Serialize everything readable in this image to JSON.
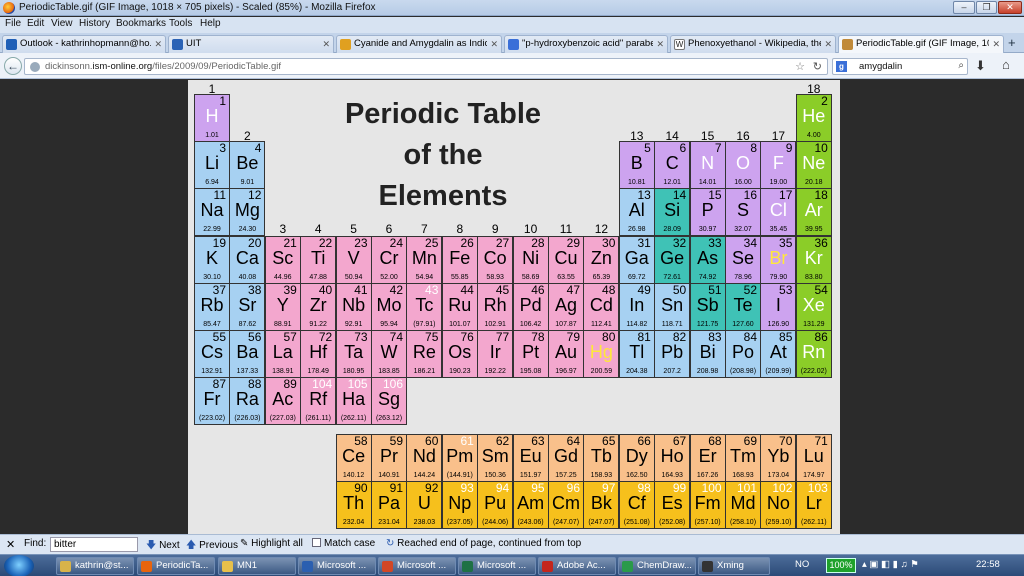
{
  "window": {
    "title": "PeriodicTable.gif (GIF Image, 1018 × 705 pixels) - Scaled (85%) - Mozilla Firefox"
  },
  "menu": [
    "File",
    "Edit",
    "View",
    "History",
    "Bookmarks",
    "Tools",
    "Help"
  ],
  "tabs": [
    {
      "label": "Outlook - kathrinhopmann@ho...",
      "color": "#1f5fb7"
    },
    {
      "label": "UIT",
      "color": "#2a62b5"
    },
    {
      "label": "Cyanide and Amygdalin as Indic...",
      "color": "#e0a020"
    },
    {
      "label": "\"p-hydroxybenzoic acid\" parabe...",
      "color": "#3a6fd8"
    },
    {
      "label": "Phenoxyethanol - Wikipedia, the...",
      "color": "#444444"
    },
    {
      "label": "PeriodicTable.gif (GIF Image, 10...",
      "color": "#c08a3a"
    }
  ],
  "new_tab": "+",
  "url": {
    "prefix": "dickinsonn.",
    "domain": "ism-online.org",
    "path": "/files/2009/09/PeriodicTable.gif"
  },
  "search": {
    "value": "amygdalin",
    "engine": "g"
  },
  "table": {
    "title_lines": [
      "Periodic Table",
      "of the",
      "Elements"
    ],
    "groups": [
      "1",
      "2",
      "3",
      "4",
      "5",
      "6",
      "7",
      "8",
      "9",
      "10",
      "11",
      "12",
      "13",
      "14",
      "15",
      "16",
      "17",
      "18"
    ],
    "elements": [
      {
        "z": "1",
        "sym": "H",
        "mass": "1.01",
        "col": 1,
        "row": 1,
        "cat": "nonmetal",
        "tc": "white"
      },
      {
        "z": "2",
        "sym": "He",
        "mass": "4.00",
        "col": 18,
        "row": 1,
        "cat": "noble",
        "tc": "white"
      },
      {
        "z": "3",
        "sym": "Li",
        "mass": "6.94",
        "col": 1,
        "row": 2,
        "cat": "alkali"
      },
      {
        "z": "4",
        "sym": "Be",
        "mass": "9.01",
        "col": 2,
        "row": 2,
        "cat": "alkali"
      },
      {
        "z": "5",
        "sym": "B",
        "mass": "10.81",
        "col": 13,
        "row": 2,
        "cat": "nonmetal"
      },
      {
        "z": "6",
        "sym": "C",
        "mass": "12.01",
        "col": 14,
        "row": 2,
        "cat": "nonmetal"
      },
      {
        "z": "7",
        "sym": "N",
        "mass": "14.01",
        "col": 15,
        "row": 2,
        "cat": "nonmetal",
        "tc": "white"
      },
      {
        "z": "8",
        "sym": "O",
        "mass": "16.00",
        "col": 16,
        "row": 2,
        "cat": "nonmetal",
        "tc": "white"
      },
      {
        "z": "9",
        "sym": "F",
        "mass": "19.00",
        "col": 17,
        "row": 2,
        "cat": "nonmetal",
        "tc": "white"
      },
      {
        "z": "10",
        "sym": "Ne",
        "mass": "20.18",
        "col": 18,
        "row": 2,
        "cat": "noble",
        "tc": "white"
      },
      {
        "z": "11",
        "sym": "Na",
        "mass": "22.99",
        "col": 1,
        "row": 3,
        "cat": "alkali"
      },
      {
        "z": "12",
        "sym": "Mg",
        "mass": "24.30",
        "col": 2,
        "row": 3,
        "cat": "alkali"
      },
      {
        "z": "13",
        "sym": "Al",
        "mass": "26.98",
        "col": 13,
        "row": 3,
        "cat": "post"
      },
      {
        "z": "14",
        "sym": "Si",
        "mass": "28.09",
        "col": 14,
        "row": 3,
        "cat": "metalloid"
      },
      {
        "z": "15",
        "sym": "P",
        "mass": "30.97",
        "col": 15,
        "row": 3,
        "cat": "nonmetal"
      },
      {
        "z": "16",
        "sym": "S",
        "mass": "32.07",
        "col": 16,
        "row": 3,
        "cat": "nonmetal"
      },
      {
        "z": "17",
        "sym": "Cl",
        "mass": "35.45",
        "col": 17,
        "row": 3,
        "cat": "nonmetal",
        "tc": "white"
      },
      {
        "z": "18",
        "sym": "Ar",
        "mass": "39.95",
        "col": 18,
        "row": 3,
        "cat": "noble",
        "tc": "white"
      },
      {
        "z": "19",
        "sym": "K",
        "mass": "30.10",
        "col": 1,
        "row": 4,
        "cat": "alkali"
      },
      {
        "z": "20",
        "sym": "Ca",
        "mass": "40.08",
        "col": 2,
        "row": 4,
        "cat": "alkali"
      },
      {
        "z": "21",
        "sym": "Sc",
        "mass": "44.96",
        "col": 3,
        "row": 4,
        "cat": "tm"
      },
      {
        "z": "22",
        "sym": "Ti",
        "mass": "47.88",
        "col": 4,
        "row": 4,
        "cat": "tm"
      },
      {
        "z": "23",
        "sym": "V",
        "mass": "50.94",
        "col": 5,
        "row": 4,
        "cat": "tm"
      },
      {
        "z": "24",
        "sym": "Cr",
        "mass": "52.00",
        "col": 6,
        "row": 4,
        "cat": "tm"
      },
      {
        "z": "25",
        "sym": "Mn",
        "mass": "54.94",
        "col": 7,
        "row": 4,
        "cat": "tm"
      },
      {
        "z": "26",
        "sym": "Fe",
        "mass": "55.85",
        "col": 8,
        "row": 4,
        "cat": "tm"
      },
      {
        "z": "27",
        "sym": "Co",
        "mass": "58.93",
        "col": 9,
        "row": 4,
        "cat": "tm"
      },
      {
        "z": "28",
        "sym": "Ni",
        "mass": "58.69",
        "col": 10,
        "row": 4,
        "cat": "tm"
      },
      {
        "z": "29",
        "sym": "Cu",
        "mass": "63.55",
        "col": 11,
        "row": 4,
        "cat": "tm"
      },
      {
        "z": "30",
        "sym": "Zn",
        "mass": "65.39",
        "col": 12,
        "row": 4,
        "cat": "tm"
      },
      {
        "z": "31",
        "sym": "Ga",
        "mass": "69.72",
        "col": 13,
        "row": 4,
        "cat": "post"
      },
      {
        "z": "32",
        "sym": "Ge",
        "mass": "72.61",
        "col": 14,
        "row": 4,
        "cat": "metalloid"
      },
      {
        "z": "33",
        "sym": "As",
        "mass": "74.92",
        "col": 15,
        "row": 4,
        "cat": "metalloid"
      },
      {
        "z": "34",
        "sym": "Se",
        "mass": "78.96",
        "col": 16,
        "row": 4,
        "cat": "nonmetal"
      },
      {
        "z": "35",
        "sym": "Br",
        "mass": "79.90",
        "col": 17,
        "row": 4,
        "cat": "nonmetal",
        "tc": "yellow"
      },
      {
        "z": "36",
        "sym": "Kr",
        "mass": "83.80",
        "col": 18,
        "row": 4,
        "cat": "noble",
        "tc": "white"
      },
      {
        "z": "37",
        "sym": "Rb",
        "mass": "85.47",
        "col": 1,
        "row": 5,
        "cat": "alkali"
      },
      {
        "z": "38",
        "sym": "Sr",
        "mass": "87.62",
        "col": 2,
        "row": 5,
        "cat": "alkali"
      },
      {
        "z": "39",
        "sym": "Y",
        "mass": "88.91",
        "col": 3,
        "row": 5,
        "cat": "tm"
      },
      {
        "z": "40",
        "sym": "Zr",
        "mass": "91.22",
        "col": 4,
        "row": 5,
        "cat": "tm"
      },
      {
        "z": "41",
        "sym": "Nb",
        "mass": "92.91",
        "col": 5,
        "row": 5,
        "cat": "tm"
      },
      {
        "z": "42",
        "sym": "Mo",
        "mass": "95.94",
        "col": 6,
        "row": 5,
        "cat": "tm"
      },
      {
        "z": "43",
        "sym": "Tc",
        "mass": "(97.91)",
        "col": 7,
        "row": 5,
        "cat": "tm",
        "nc": "white"
      },
      {
        "z": "44",
        "sym": "Ru",
        "mass": "101.07",
        "col": 8,
        "row": 5,
        "cat": "tm"
      },
      {
        "z": "45",
        "sym": "Rh",
        "mass": "102.91",
        "col": 9,
        "row": 5,
        "cat": "tm"
      },
      {
        "z": "46",
        "sym": "Pd",
        "mass": "106.42",
        "col": 10,
        "row": 5,
        "cat": "tm"
      },
      {
        "z": "47",
        "sym": "Ag",
        "mass": "107.87",
        "col": 11,
        "row": 5,
        "cat": "tm"
      },
      {
        "z": "48",
        "sym": "Cd",
        "mass": "112.41",
        "col": 12,
        "row": 5,
        "cat": "tm"
      },
      {
        "z": "49",
        "sym": "In",
        "mass": "114.82",
        "col": 13,
        "row": 5,
        "cat": "post"
      },
      {
        "z": "50",
        "sym": "Sn",
        "mass": "118.71",
        "col": 14,
        "row": 5,
        "cat": "post"
      },
      {
        "z": "51",
        "sym": "Sb",
        "mass": "121.75",
        "col": 15,
        "row": 5,
        "cat": "metalloid"
      },
      {
        "z": "52",
        "sym": "Te",
        "mass": "127.60",
        "col": 16,
        "row": 5,
        "cat": "metalloid"
      },
      {
        "z": "53",
        "sym": "I",
        "mass": "126.90",
        "col": 17,
        "row": 5,
        "cat": "nonmetal"
      },
      {
        "z": "54",
        "sym": "Xe",
        "mass": "131.29",
        "col": 18,
        "row": 5,
        "cat": "noble",
        "tc": "white"
      },
      {
        "z": "55",
        "sym": "Cs",
        "mass": "132.91",
        "col": 1,
        "row": 6,
        "cat": "alkali"
      },
      {
        "z": "56",
        "sym": "Ba",
        "mass": "137.33",
        "col": 2,
        "row": 6,
        "cat": "alkali"
      },
      {
        "z": "57",
        "sym": "La",
        "mass": "138.91",
        "col": 3,
        "row": 6,
        "cat": "tm"
      },
      {
        "z": "72",
        "sym": "Hf",
        "mass": "178.49",
        "col": 4,
        "row": 6,
        "cat": "tm"
      },
      {
        "z": "73",
        "sym": "Ta",
        "mass": "180.95",
        "col": 5,
        "row": 6,
        "cat": "tm"
      },
      {
        "z": "74",
        "sym": "W",
        "mass": "183.85",
        "col": 6,
        "row": 6,
        "cat": "tm"
      },
      {
        "z": "75",
        "sym": "Re",
        "mass": "186.21",
        "col": 7,
        "row": 6,
        "cat": "tm"
      },
      {
        "z": "76",
        "sym": "Os",
        "mass": "190.23",
        "col": 8,
        "row": 6,
        "cat": "tm"
      },
      {
        "z": "77",
        "sym": "Ir",
        "mass": "192.22",
        "col": 9,
        "row": 6,
        "cat": "tm"
      },
      {
        "z": "78",
        "sym": "Pt",
        "mass": "195.08",
        "col": 10,
        "row": 6,
        "cat": "tm"
      },
      {
        "z": "79",
        "sym": "Au",
        "mass": "196.97",
        "col": 11,
        "row": 6,
        "cat": "tm"
      },
      {
        "z": "80",
        "sym": "Hg",
        "mass": "200.59",
        "col": 12,
        "row": 6,
        "cat": "tm",
        "tc": "yellow"
      },
      {
        "z": "81",
        "sym": "Tl",
        "mass": "204.38",
        "col": 13,
        "row": 6,
        "cat": "post"
      },
      {
        "z": "82",
        "sym": "Pb",
        "mass": "207.2",
        "col": 14,
        "row": 6,
        "cat": "post"
      },
      {
        "z": "83",
        "sym": "Bi",
        "mass": "208.98",
        "col": 15,
        "row": 6,
        "cat": "post"
      },
      {
        "z": "84",
        "sym": "Po",
        "mass": "(208.98)",
        "col": 16,
        "row": 6,
        "cat": "post"
      },
      {
        "z": "85",
        "sym": "At",
        "mass": "(209.99)",
        "col": 17,
        "row": 6,
        "cat": "post"
      },
      {
        "z": "86",
        "sym": "Rn",
        "mass": "(222.02)",
        "col": 18,
        "row": 6,
        "cat": "noble",
        "tc": "white"
      },
      {
        "z": "87",
        "sym": "Fr",
        "mass": "(223.02)",
        "col": 1,
        "row": 7,
        "cat": "alkali"
      },
      {
        "z": "88",
        "sym": "Ra",
        "mass": "(226.03)",
        "col": 2,
        "row": 7,
        "cat": "alkali"
      },
      {
        "z": "89",
        "sym": "Ac",
        "mass": "(227.03)",
        "col": 3,
        "row": 7,
        "cat": "tm"
      },
      {
        "z": "104",
        "sym": "Rf",
        "mass": "(261.11)",
        "col": 4,
        "row": 7,
        "cat": "tm",
        "nc": "white"
      },
      {
        "z": "105",
        "sym": "Ha",
        "mass": "(262.11)",
        "col": 5,
        "row": 7,
        "cat": "tm",
        "nc": "white"
      },
      {
        "z": "106",
        "sym": "Sg",
        "mass": "(263.12)",
        "col": 6,
        "row": 7,
        "cat": "tm",
        "nc": "white"
      },
      {
        "z": "58",
        "sym": "Ce",
        "mass": "140.12",
        "col": 5,
        "row": 9,
        "cat": "lan"
      },
      {
        "z": "59",
        "sym": "Pr",
        "mass": "140.91",
        "col": 6,
        "row": 9,
        "cat": "lan"
      },
      {
        "z": "60",
        "sym": "Nd",
        "mass": "144.24",
        "col": 7,
        "row": 9,
        "cat": "lan"
      },
      {
        "z": "61",
        "sym": "Pm",
        "mass": "(144.91)",
        "col": 8,
        "row": 9,
        "cat": "lan",
        "nc": "white"
      },
      {
        "z": "62",
        "sym": "Sm",
        "mass": "150.36",
        "col": 9,
        "row": 9,
        "cat": "lan"
      },
      {
        "z": "63",
        "sym": "Eu",
        "mass": "151.97",
        "col": 10,
        "row": 9,
        "cat": "lan"
      },
      {
        "z": "64",
        "sym": "Gd",
        "mass": "157.25",
        "col": 11,
        "row": 9,
        "cat": "lan"
      },
      {
        "z": "65",
        "sym": "Tb",
        "mass": "158.93",
        "col": 12,
        "row": 9,
        "cat": "lan"
      },
      {
        "z": "66",
        "sym": "Dy",
        "mass": "162.50",
        "col": 13,
        "row": 9,
        "cat": "lan"
      },
      {
        "z": "67",
        "sym": "Ho",
        "mass": "164.93",
        "col": 14,
        "row": 9,
        "cat": "lan"
      },
      {
        "z": "68",
        "sym": "Er",
        "mass": "167.26",
        "col": 15,
        "row": 9,
        "cat": "lan"
      },
      {
        "z": "69",
        "sym": "Tm",
        "mass": "168.93",
        "col": 16,
        "row": 9,
        "cat": "lan"
      },
      {
        "z": "70",
        "sym": "Yb",
        "mass": "173.04",
        "col": 17,
        "row": 9,
        "cat": "lan"
      },
      {
        "z": "71",
        "sym": "Lu",
        "mass": "174.97",
        "col": 18,
        "row": 9,
        "cat": "lan"
      },
      {
        "z": "90",
        "sym": "Th",
        "mass": "232.04",
        "col": 5,
        "row": 10,
        "cat": "act"
      },
      {
        "z": "91",
        "sym": "Pa",
        "mass": "231.04",
        "col": 6,
        "row": 10,
        "cat": "act"
      },
      {
        "z": "92",
        "sym": "U",
        "mass": "238.03",
        "col": 7,
        "row": 10,
        "cat": "act"
      },
      {
        "z": "93",
        "sym": "Np",
        "mass": "(237.05)",
        "col": 8,
        "row": 10,
        "cat": "act",
        "nc": "white"
      },
      {
        "z": "94",
        "sym": "Pu",
        "mass": "(244.06)",
        "col": 9,
        "row": 10,
        "cat": "act",
        "nc": "white"
      },
      {
        "z": "95",
        "sym": "Am",
        "mass": "(243.06)",
        "col": 10,
        "row": 10,
        "cat": "act",
        "nc": "white"
      },
      {
        "z": "96",
        "sym": "Cm",
        "mass": "(247.07)",
        "col": 11,
        "row": 10,
        "cat": "act",
        "nc": "white"
      },
      {
        "z": "97",
        "sym": "Bk",
        "mass": "(247.07)",
        "col": 12,
        "row": 10,
        "cat": "act",
        "nc": "white"
      },
      {
        "z": "98",
        "sym": "Cf",
        "mass": "(251.08)",
        "col": 13,
        "row": 10,
        "cat": "act",
        "nc": "white"
      },
      {
        "z": "99",
        "sym": "Es",
        "mass": "(252.08)",
        "col": 14,
        "row": 10,
        "cat": "act",
        "nc": "white"
      },
      {
        "z": "100",
        "sym": "Fm",
        "mass": "(257.10)",
        "col": 15,
        "row": 10,
        "cat": "act",
        "nc": "white"
      },
      {
        "z": "101",
        "sym": "Md",
        "mass": "(258.10)",
        "col": 16,
        "row": 10,
        "cat": "act",
        "nc": "white"
      },
      {
        "z": "102",
        "sym": "No",
        "mass": "(259.10)",
        "col": 17,
        "row": 10,
        "cat": "act",
        "nc": "white"
      },
      {
        "z": "103",
        "sym": "Lr",
        "mass": "(262.11)",
        "col": 18,
        "row": 10,
        "cat": "act",
        "nc": "white"
      }
    ]
  },
  "findbar": {
    "close": "✕",
    "label": "Find:",
    "value": "bitter",
    "next": "Next",
    "previous": "Previous",
    "highlight": "Highlight all",
    "match_case": "Match case",
    "status": "Reached end of page, continued from top"
  },
  "taskbar": {
    "items": [
      {
        "label": "kathrin@st...",
        "color": "#d8b34a"
      },
      {
        "label": "PeriodicTa...",
        "color": "#e8640d"
      },
      {
        "label": "MN1",
        "color": "#e8c04a"
      },
      {
        "label": "Microsoft ...",
        "color": "#2b5fb0"
      },
      {
        "label": "Microsoft ...",
        "color": "#d24726"
      },
      {
        "label": "Microsoft ...",
        "color": "#1e7145"
      },
      {
        "label": "Adobe Ac...",
        "color": "#c4261d"
      },
      {
        "label": "ChemDraw...",
        "color": "#2a9a4a"
      },
      {
        "label": "Xming",
        "color": "#333333"
      }
    ],
    "lang": "NO",
    "battery": "100%",
    "clock": "22:58"
  }
}
